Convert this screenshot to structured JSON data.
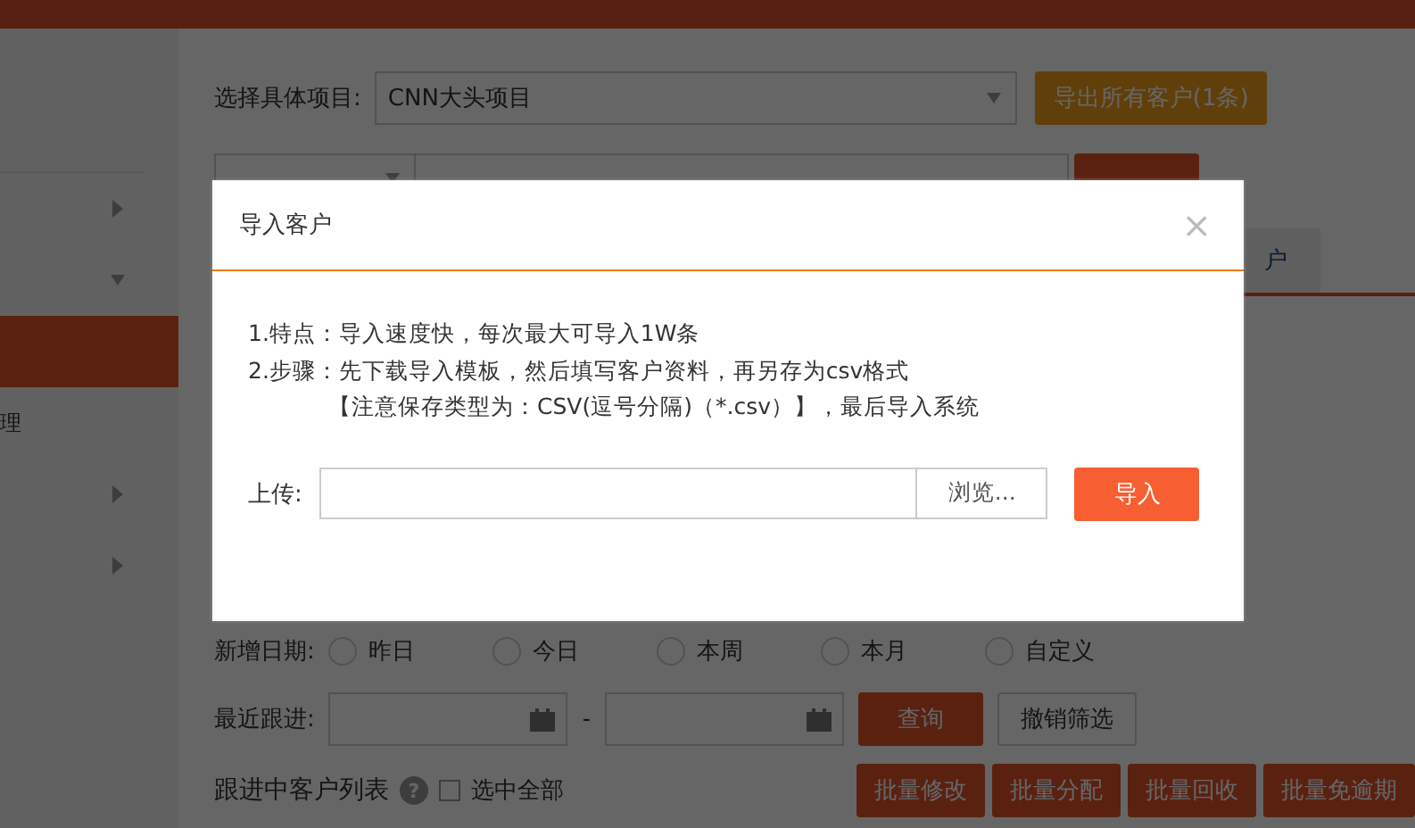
{
  "sidebar": {
    "items": [
      {
        "has_submenu": true,
        "expanded": false,
        "selected": false
      },
      {
        "has_submenu": true,
        "expanded": true,
        "selected": false
      },
      {
        "has_submenu": false,
        "selected": true
      },
      {
        "label": "理",
        "has_submenu": false,
        "selected": false
      },
      {
        "has_submenu": true,
        "expanded": false,
        "selected": false
      },
      {
        "has_submenu": true,
        "expanded": false,
        "selected": false
      }
    ]
  },
  "project": {
    "label": "选择具体项目:",
    "value": "CNN大头项目",
    "export_button": "导出所有客户(1条)"
  },
  "tabs": [
    {
      "label": "户",
      "selected": true
    }
  ],
  "filters": {
    "date_label": "新增日期:",
    "date_options": [
      {
        "label": "昨日",
        "selected": false
      },
      {
        "label": "今日",
        "selected": false
      },
      {
        "label": "本周",
        "selected": false
      },
      {
        "label": "本月",
        "selected": false
      },
      {
        "label": "自定义",
        "selected": false
      }
    ],
    "follow_label": "最近跟进:",
    "separator": "-",
    "query_button": "查询",
    "reset_button": "撤销筛选"
  },
  "list": {
    "title": "跟进中客户列表",
    "help": "?",
    "select_all": {
      "label": "选中全部",
      "checked": false
    },
    "actions": [
      "批量修改",
      "批量分配",
      "批量回收",
      "批量免逾期"
    ]
  },
  "dialog": {
    "title": "导入客户",
    "close": "×",
    "lines": [
      "1.特点：导入速度快，每次最大可导入1W条",
      "2.步骤：先下载导入模板，然后填写客户资料，再另存为csv格式",
      "【注意保存类型为：CSV(逗号分隔)（*.csv）】，最后导入系统"
    ],
    "upload_label": "上传:",
    "browse_button": "浏览...",
    "import_button": "导入"
  }
}
